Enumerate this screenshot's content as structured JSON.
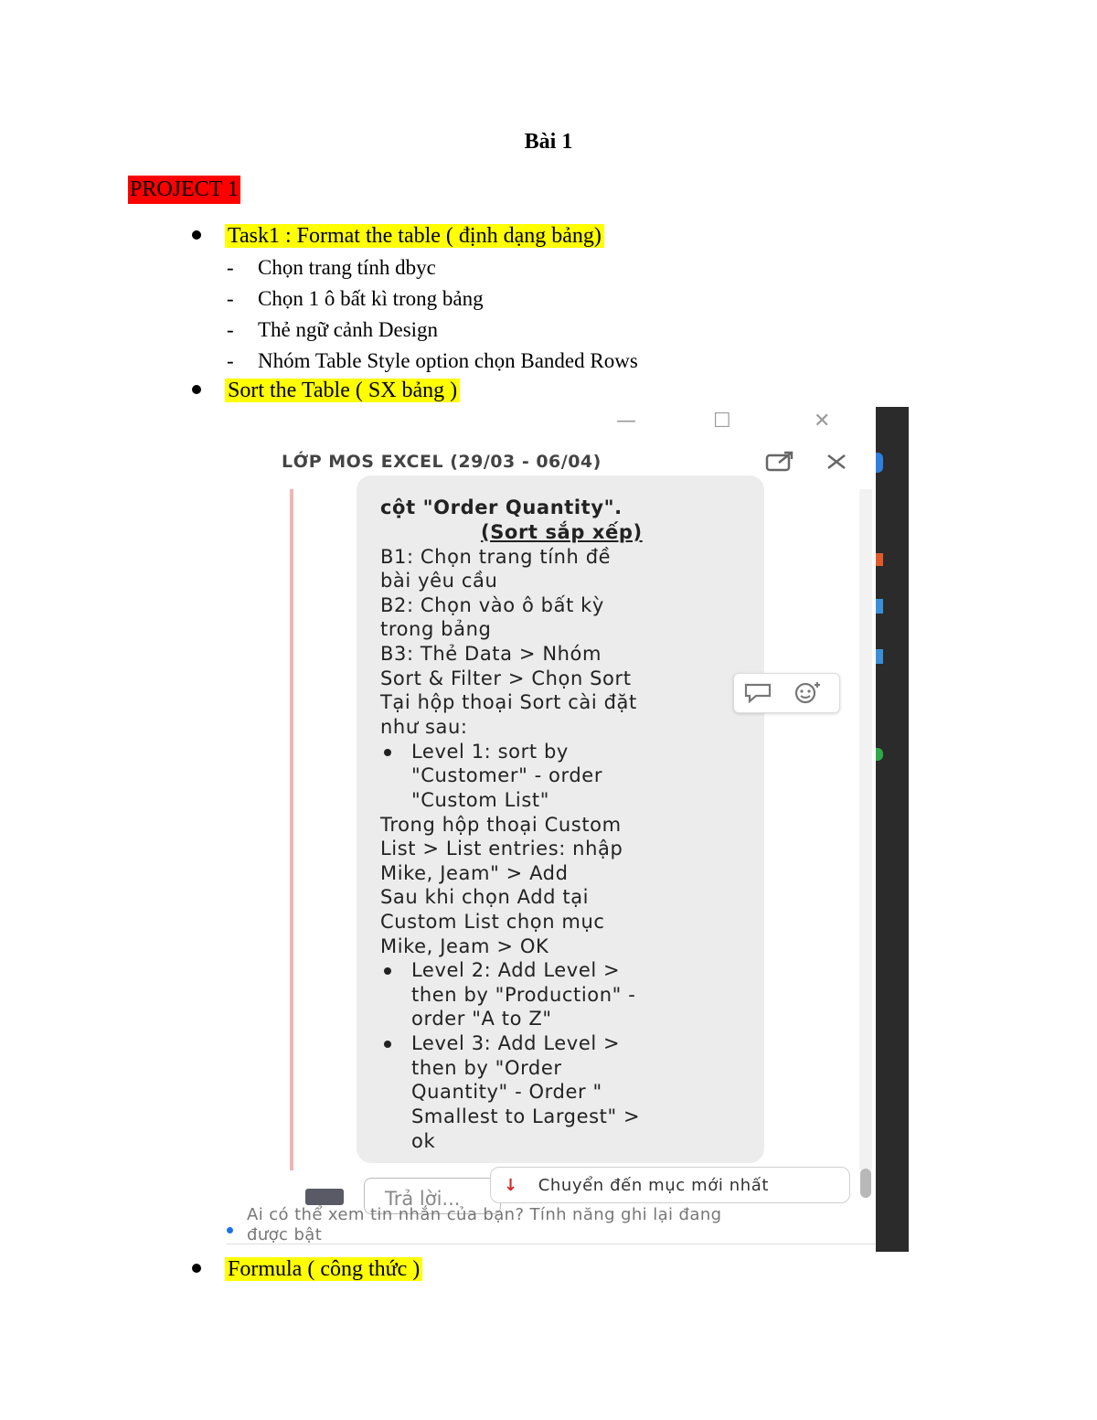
{
  "doc": {
    "title": "Bài 1",
    "project_label": "PROJECT 1",
    "task1": "Task1 : Format the table ( định dạng bảng)",
    "steps": [
      "Chọn trang tính dbyc",
      "Chọn 1 ô bất kì trong bảng",
      "Thẻ ngữ cảnh Design",
      "Nhóm Table Style option chọn Banded Rows"
    ],
    "sort_heading": "Sort the Table ( SX bảng )",
    "formula_heading": "Formula ( công thức )"
  },
  "screenshot": {
    "window_controls": {
      "minimize": "—",
      "maximize": "☐",
      "close": "✕"
    },
    "chat_title": "LỚP MOS EXCEL (29/03 - 06/04)",
    "popout_icon": "popout-icon",
    "close_icon": "close-icon",
    "message": {
      "line0": "cột \"Order Quantity\".",
      "line1": "(Sort sắp xếp)",
      "line2": "B1: Chọn trang tính đề",
      "line3": "bài yêu cầu",
      "line4": "B2: Chọn vào ô bất kỳ",
      "line5": "trong bảng",
      "line6": "B3: Thẻ Data > Nhóm",
      "line7": "Sort & Filter > Chọn Sort",
      "line8": "Tại hộp thoại Sort cài đặt",
      "line9": "như sau:",
      "b1_l1": "Level 1: sort by",
      "b1_l2": "\"Customer\" - order",
      "b1_l3": "\"Custom List\"",
      "line13": "Trong hộp thoại Custom",
      "line14": "List > List entries: nhập",
      "line15": "Mike, Jeam\" > Add",
      "line16": "Sau khi chọn Add tại",
      "line17": "Custom List chọn mục",
      "line18": "Mike, Jeam > OK",
      "b2_l1": "Level 2: Add Level >",
      "b2_l2": "then by \"Production\" -",
      "b2_l3": "order \"A to Z\"",
      "b3_l1": "Level 3: Add Level >",
      "b3_l2": "then by \"Order",
      "b3_l3": "Quantity\" - Order \"",
      "b3_l4": "Smallest to Largest\" >",
      "b3_l5": "ok"
    },
    "react_icons": [
      "reply-icon",
      "emoji-add-icon"
    ],
    "reply_placeholder": "Trả lời...",
    "jump_arrow": "↓",
    "jump_label": "Chuyển đến mục mới nhất",
    "notice_line1": "Ai có thể xem tin nhắn của bạn? Tính năng ghi lại đang",
    "notice_line2": "được bật",
    "accent_colors": {
      "highlight": "#ffff00",
      "project": "#ff0000",
      "arrow": "#d42a2a"
    }
  }
}
